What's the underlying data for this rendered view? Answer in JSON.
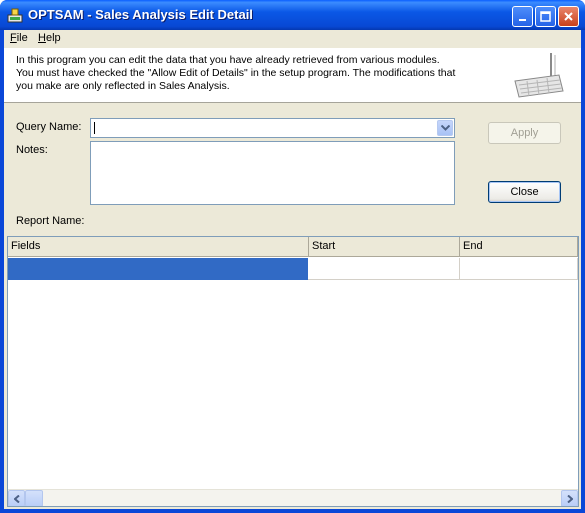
{
  "window": {
    "title": "OPTSAM - Sales Analysis Edit Detail"
  },
  "menu": {
    "file": {
      "label_ul": "F",
      "label_rest": "ile"
    },
    "help": {
      "label_ul": "H",
      "label_rest": "elp"
    }
  },
  "info": {
    "text": "In this program you can edit the data that you have already retrieved from various modules. You must have checked the \"Allow Edit of Details\" in the setup program. The modifications that you make are only reflected in Sales Analysis."
  },
  "form": {
    "query_name_label": "Query Name:",
    "query_name_value": "",
    "notes_label": "Notes:",
    "notes_value": "",
    "report_name_label": "Report Name:",
    "report_name_value": "",
    "apply_label": "Apply",
    "close_label": "Close"
  },
  "grid": {
    "columns": [
      "Fields",
      "Start",
      "End"
    ],
    "rows": [
      [
        "",
        "",
        ""
      ]
    ]
  },
  "colors": {
    "titlebar": "#0a47d8",
    "selection": "#316ac5",
    "face": "#ece9d8"
  }
}
